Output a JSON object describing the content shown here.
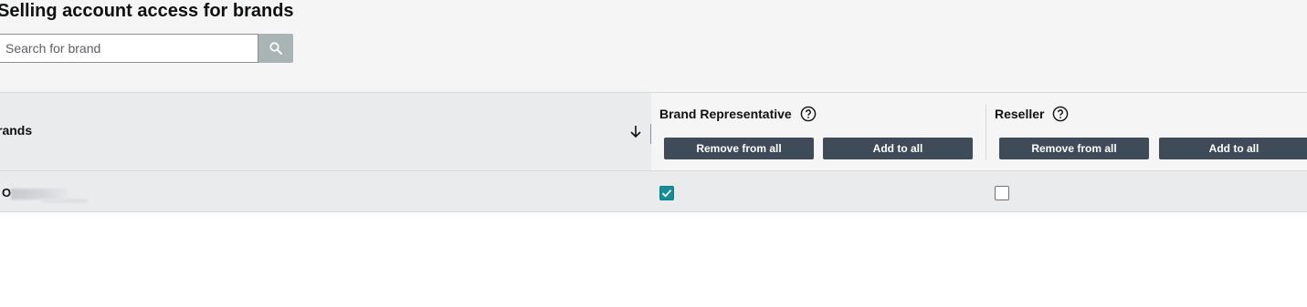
{
  "header": {
    "title": "Selling account access for brands",
    "search_placeholder": "Search for brand",
    "search_value": ""
  },
  "table": {
    "brand_column": "rands",
    "columns": [
      {
        "title": "Brand Representative",
        "remove_label": "Remove from all",
        "add_label": "Add to all"
      },
      {
        "title": "Reseller",
        "remove_label": "Remove from all",
        "add_label": "Add to all"
      }
    ],
    "rows": [
      {
        "brand": "O",
        "brand_representative": true,
        "reseller": false
      }
    ]
  },
  "icons": [
    "search-icon",
    "sort-down-icon",
    "help-icon",
    "checkmark-icon"
  ],
  "colors": {
    "button_dark": "#3f4b58",
    "checkbox_checked": "#138e98",
    "search_button": "#a9b4b5"
  }
}
